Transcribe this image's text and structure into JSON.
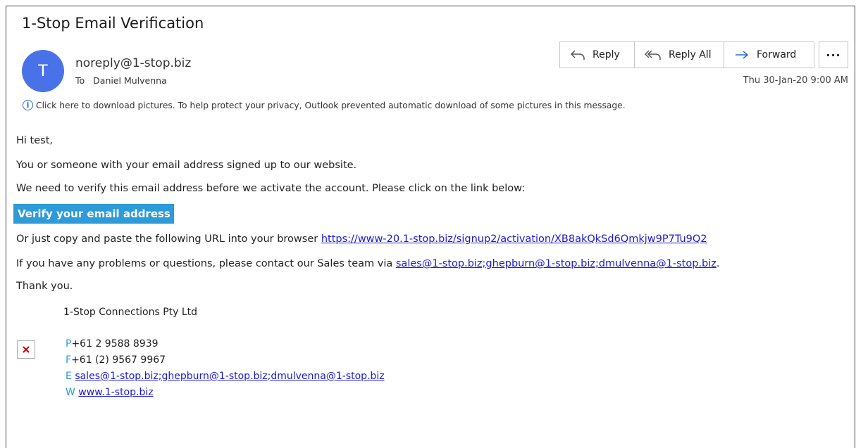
{
  "subject": "1-Stop Email Verification",
  "sender": {
    "avatar_initial": "T",
    "email": "noreply@1-stop.biz",
    "to_label": "To",
    "to_name": "Daniel Mulvenna",
    "date": "Thu 30-Jan-20 9:00 AM"
  },
  "toolbar": {
    "reply": "Reply",
    "reply_all": "Reply All",
    "forward": "Forward",
    "more": "···"
  },
  "info_bar": "Click here to download pictures. To help protect your privacy, Outlook prevented automatic download of some pictures in this message.",
  "message": {
    "greeting": "Hi test,",
    "line1": "You or someone with your email address signed up to our website.",
    "line2": "We need to verify this email address before we activate the account. Please click on the link below:",
    "verify_button": "Verify your email address",
    "url_prefix": "Or just copy and paste the following URL into your browser ",
    "url": "https://www-20.1-stop.biz/signup2/activation/XB8akQkSd6Qmkjw9P7Tu9Q2",
    "contact_prefix": "If you have any problems or questions, please contact our Sales team via ",
    "contact_email": "sales@1-stop.biz;ghepburn@1-stop.biz;dmulvenna@1-stop.biz",
    "contact_suffix": ".",
    "thanks": "Thank you."
  },
  "signature": {
    "company": "1-Stop Connections Pty Ltd",
    "phone_label": "P",
    "phone": "+61 2 9588 8939",
    "fax_label": "F",
    "fax": "+61 (2) 9567 9967",
    "email_label": "E",
    "email": "sales@1-stop.biz;ghepburn@1-stop.biz;dmulvenna@1-stop.biz",
    "web_label": "W",
    "web": "www.1-stop.biz"
  },
  "colors": {
    "avatar": "#4a72e8",
    "accent": "#2d9bd8",
    "link": "#1a1ad6",
    "info_icon": "#2a6ad4"
  },
  "icons": {
    "reply": "reply-arrow-icon",
    "reply_all": "reply-all-arrow-icon",
    "forward": "forward-arrow-icon",
    "info": "info-icon",
    "broken_image": "broken-image-icon"
  }
}
